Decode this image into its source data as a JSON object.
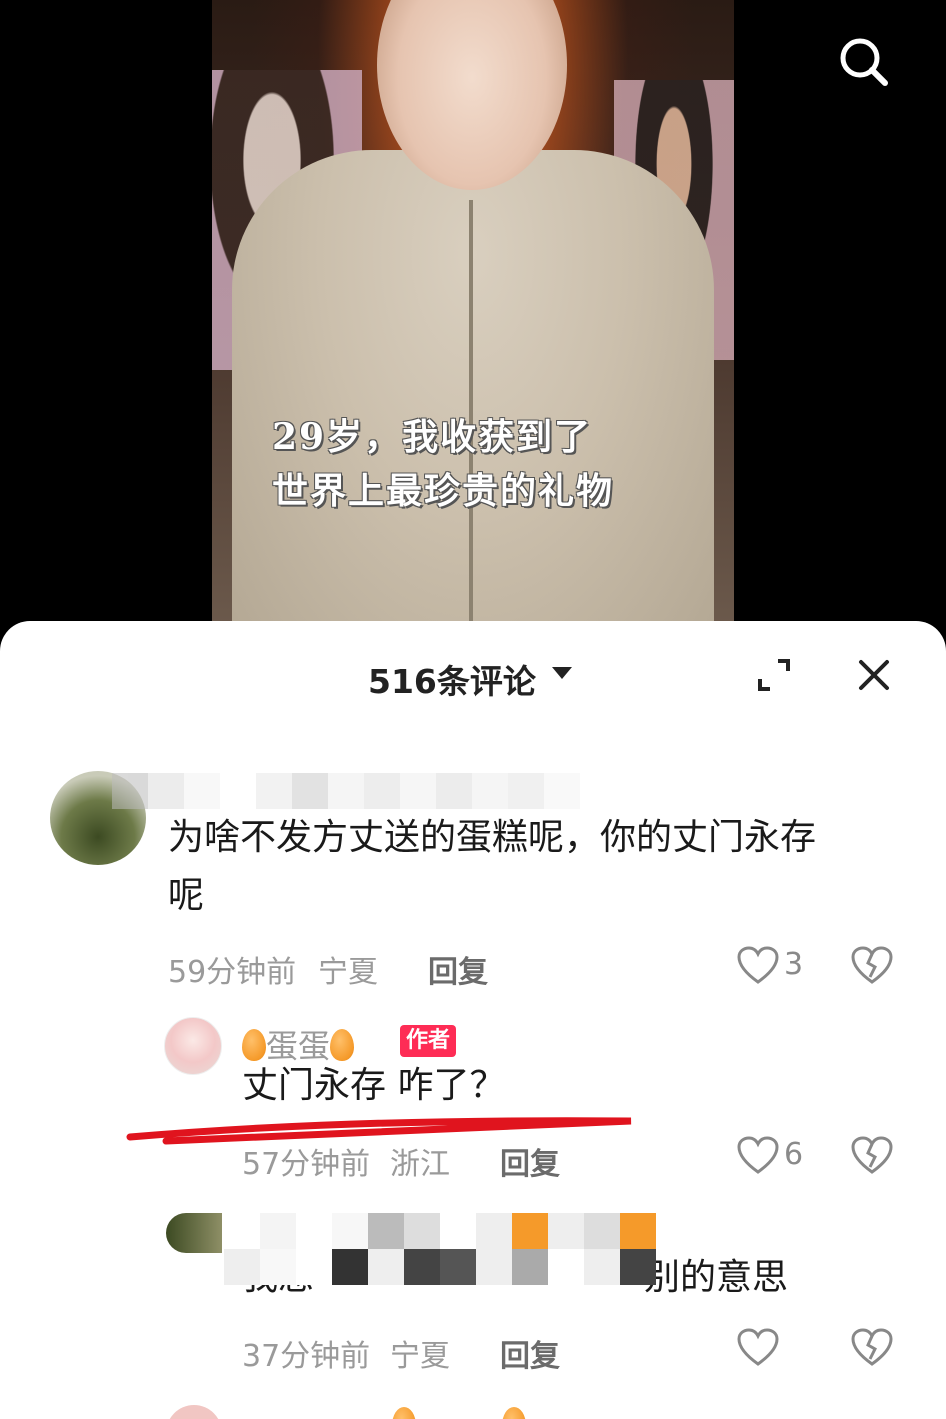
{
  "video": {
    "subtitle_line1": "29岁，我收获到了",
    "subtitle_line2": "世界上最珍贵的礼物"
  },
  "header": {
    "comment_count_title": "516条评论",
    "icons": [
      "search-icon",
      "expand-icon",
      "close-icon",
      "caret-down-icon"
    ]
  },
  "comments": [
    {
      "text_line1": "为啥不发方丈送的蛋糕呢，你的丈门永存",
      "text_line2": "呢",
      "time": "59分钟前",
      "location": "宁夏",
      "reply_label": "回复",
      "likes": "3"
    },
    {
      "name": "蛋蛋",
      "badge": "作者",
      "text": "丈门永存 咋了？",
      "time": "57分钟前",
      "location": "浙江",
      "reply_label": "回复",
      "likes": "6"
    },
    {
      "text_visible_start": "我息",
      "text_visible_end": "别的意思",
      "time": "37分钟前",
      "location": "宁夏",
      "reply_label": "回复",
      "likes": ""
    }
  ],
  "colors": {
    "author_badge": "#fe2c55",
    "underline": "#e0141e",
    "sheet_bg": "#ffffff"
  }
}
